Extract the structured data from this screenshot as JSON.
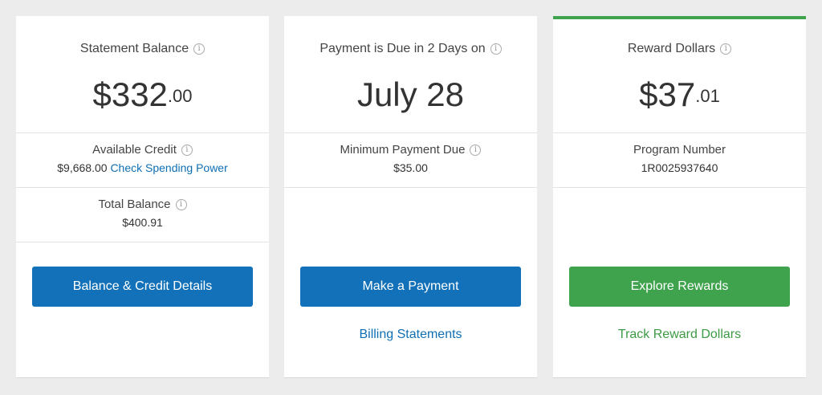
{
  "colors": {
    "primary_blue": "#1271b8",
    "link_blue": "#0f6fb3",
    "green": "#3fa34d",
    "green_link": "#3c9a44",
    "top_bar_green": "#3fa34d"
  },
  "card1": {
    "title": "Statement Balance",
    "amount_whole": "$332",
    "amount_cents": ".00",
    "available_credit_label": "Available Credit",
    "available_credit_value": "$9,668.00",
    "check_spending_power_link": "Check Spending Power",
    "total_balance_label": "Total Balance",
    "total_balance_value": "$400.91",
    "button_label": "Balance & Credit Details"
  },
  "card2": {
    "title": "Payment is Due in 2 Days on",
    "due_date": "July 28",
    "min_payment_label": "Minimum Payment Due",
    "min_payment_value": "$35.00",
    "button_label": "Make a Payment",
    "billing_link": "Billing Statements"
  },
  "card3": {
    "title": "Reward Dollars",
    "amount_whole": "$37",
    "amount_cents": ".01",
    "program_number_label": "Program Number",
    "program_number_value": "1R0025937640",
    "button_label": "Explore Rewards",
    "track_link": "Track Reward Dollars"
  },
  "icons": {
    "info": "i"
  }
}
